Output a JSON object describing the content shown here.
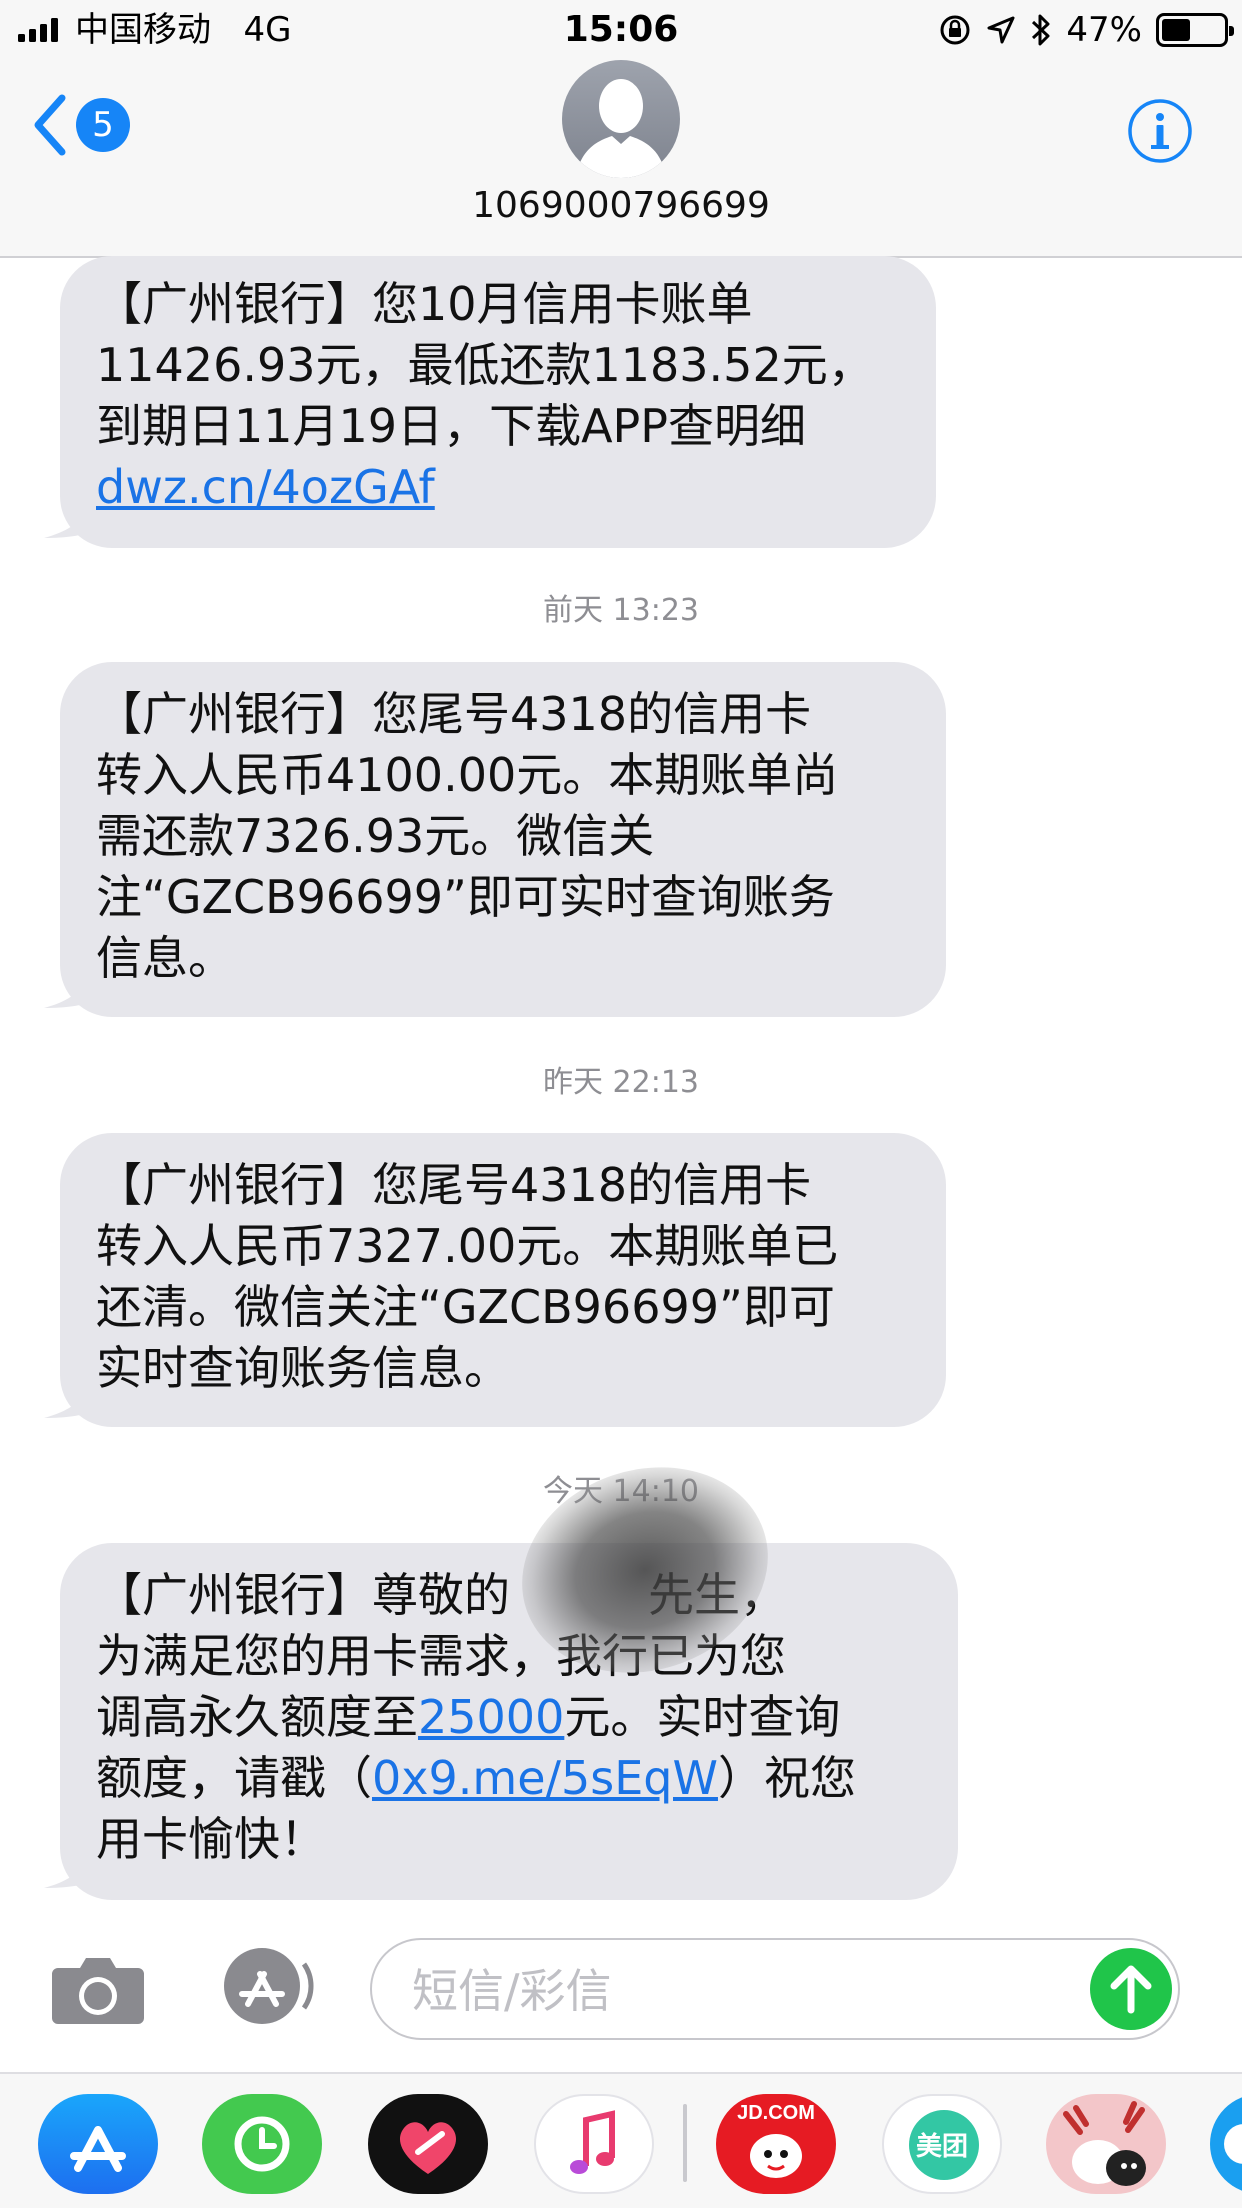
{
  "status_bar": {
    "carrier": "中国移动",
    "network": "4G",
    "time": "15:06",
    "battery_percent_text": "47%",
    "battery_level": 0.47
  },
  "header": {
    "back_badge_count": "5",
    "contact_number": "1069000796699"
  },
  "messages": [
    {
      "lines": [
        {
          "text": "【广州银行】您10月信用卡账单"
        },
        {
          "text": "11426.93元，最低还款1183.52元，"
        },
        {
          "text": "到期日11月19日，下载APP查明细"
        },
        {
          "text": "dwz.cn/4ozGAf"
        }
      ]
    },
    {
      "timestamp": "前天 13:23",
      "lines": [
        {
          "text": "【广州银行】您尾号4318的信用卡"
        },
        {
          "text": "转入人民币4100.00元。本期账单尚"
        },
        {
          "text": "需还款7326.93元。微信关"
        },
        {
          "text": "注“GZCB96699”即可实时查询账务"
        },
        {
          "text": "信息。"
        }
      ]
    },
    {
      "timestamp": "昨天 22:13",
      "lines": [
        {
          "text": "【广州银行】您尾号4318的信用卡"
        },
        {
          "text": "转入人民币7327.00元。本期账单已"
        },
        {
          "text": "还清。微信关注“GZCB96699”即可"
        },
        {
          "text": "实时查询账务信息。"
        }
      ]
    },
    {
      "timestamp": "今天 14:10",
      "lines": [
        {
          "text": "【广州银行】尊敬的　　　先生，"
        },
        {
          "text": "为满足您的用卡需求，我行已为您"
        },
        {
          "pre": "调高永久额度至",
          "link": "25000",
          "post": "元。实时查询"
        },
        {
          "pre": "额度，请戳（",
          "link": "0x9.me/5sEqW",
          "post": "）祝您"
        },
        {
          "text": "用卡愉快！"
        }
      ]
    }
  ],
  "input": {
    "placeholder": "短信/彩信"
  },
  "app_drawer": {
    "jd_label": "JD.COM",
    "meituan_label": "美团"
  }
}
